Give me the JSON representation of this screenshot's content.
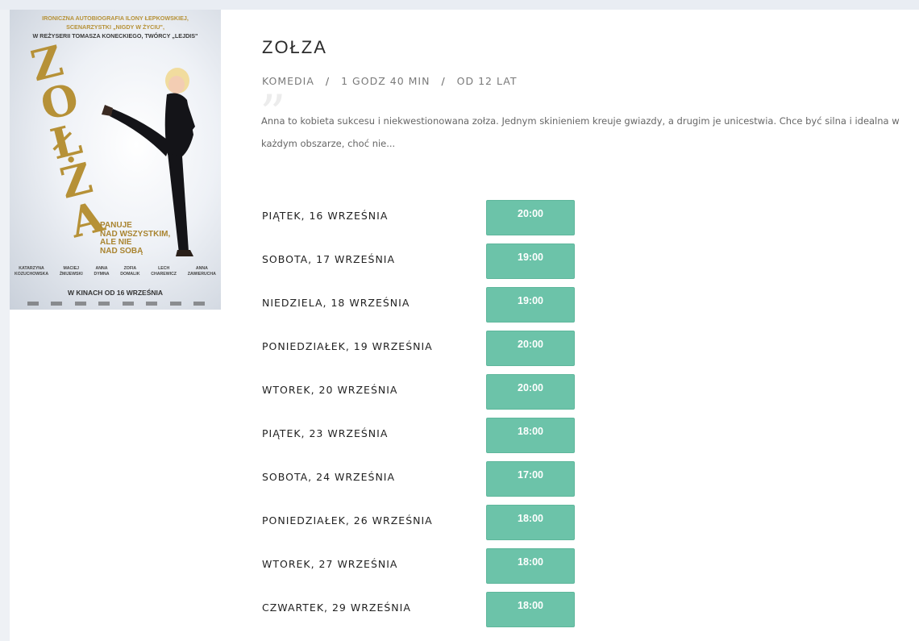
{
  "poster": {
    "alt": "Zołza movie poster",
    "credits": [
      {
        "text": "IRONICZNA AUTOBIOGRAFIA ILONY ŁEPKOWSKIEJ,",
        "gold": true
      },
      {
        "text": "SCENARZYSTKI „NIGDY W ŻYCIU\",",
        "gold": true
      },
      {
        "text": "W REŻYSERII TOMASZA KONECKIEGO, TWÓRCY „LEJDIS\"",
        "gold": false
      }
    ],
    "big_title_letters": [
      "Z",
      "O",
      "Ł",
      "Ż",
      "A"
    ],
    "tagline": [
      "PANUJE",
      "NAD WSZYSTKIM,",
      "ALE NIE",
      "NAD SOBĄ"
    ],
    "cast": [
      [
        "KATARZYNA",
        "KOZUCHOWSKA"
      ],
      [
        "MACIEJ",
        "ŻMIJEWSKI"
      ],
      [
        "ANNA",
        "DYMNA"
      ],
      [
        "ZOFIA",
        "DOMALIK"
      ],
      [
        "LECH",
        "CHAREWICZ"
      ],
      [
        "ANNA",
        "ZAWIERUCHA"
      ]
    ],
    "release": "W KINACH OD 16 WRZEŚNIA"
  },
  "movie": {
    "title": "ZOŁZA",
    "genre": "KOMEDIA",
    "duration": "1 GODZ 40 MIN",
    "age": "OD 12 LAT",
    "separator": "/",
    "quote_mark": "”",
    "description": "Anna to kobieta sukcesu i niekwestionowana zołza. Jednym skinieniem kreuje gwiazdy, a drugim je unicestwia. Chce być silna i idealna w każdym obszarze, choć nie..."
  },
  "schedule": [
    {
      "day": "PIĄTEK, 16 WRZEŚNIA",
      "time": "20:00"
    },
    {
      "day": "SOBOTA, 17 WRZEŚNIA",
      "time": "19:00"
    },
    {
      "day": "NIEDZIELA, 18 WRZEŚNIA",
      "time": "19:00"
    },
    {
      "day": "PONIEDZIAŁEK, 19 WRZEŚNIA",
      "time": "20:00"
    },
    {
      "day": "WTOREK, 20 WRZEŚNIA",
      "time": "20:00"
    },
    {
      "day": "PIĄTEK, 23 WRZEŚNIA",
      "time": "18:00"
    },
    {
      "day": "SOBOTA, 24 WRZEŚNIA",
      "time": "17:00"
    },
    {
      "day": "PONIEDZIAŁEK, 26 WRZEŚNIA",
      "time": "18:00"
    },
    {
      "day": "WTOREK, 27 WRZEŚNIA",
      "time": "18:00"
    },
    {
      "day": "CZWARTEK, 29 WRZEŚNIA",
      "time": "18:00"
    }
  ],
  "colors": {
    "accent": "#6cc3a9",
    "gold": "#b69137"
  }
}
